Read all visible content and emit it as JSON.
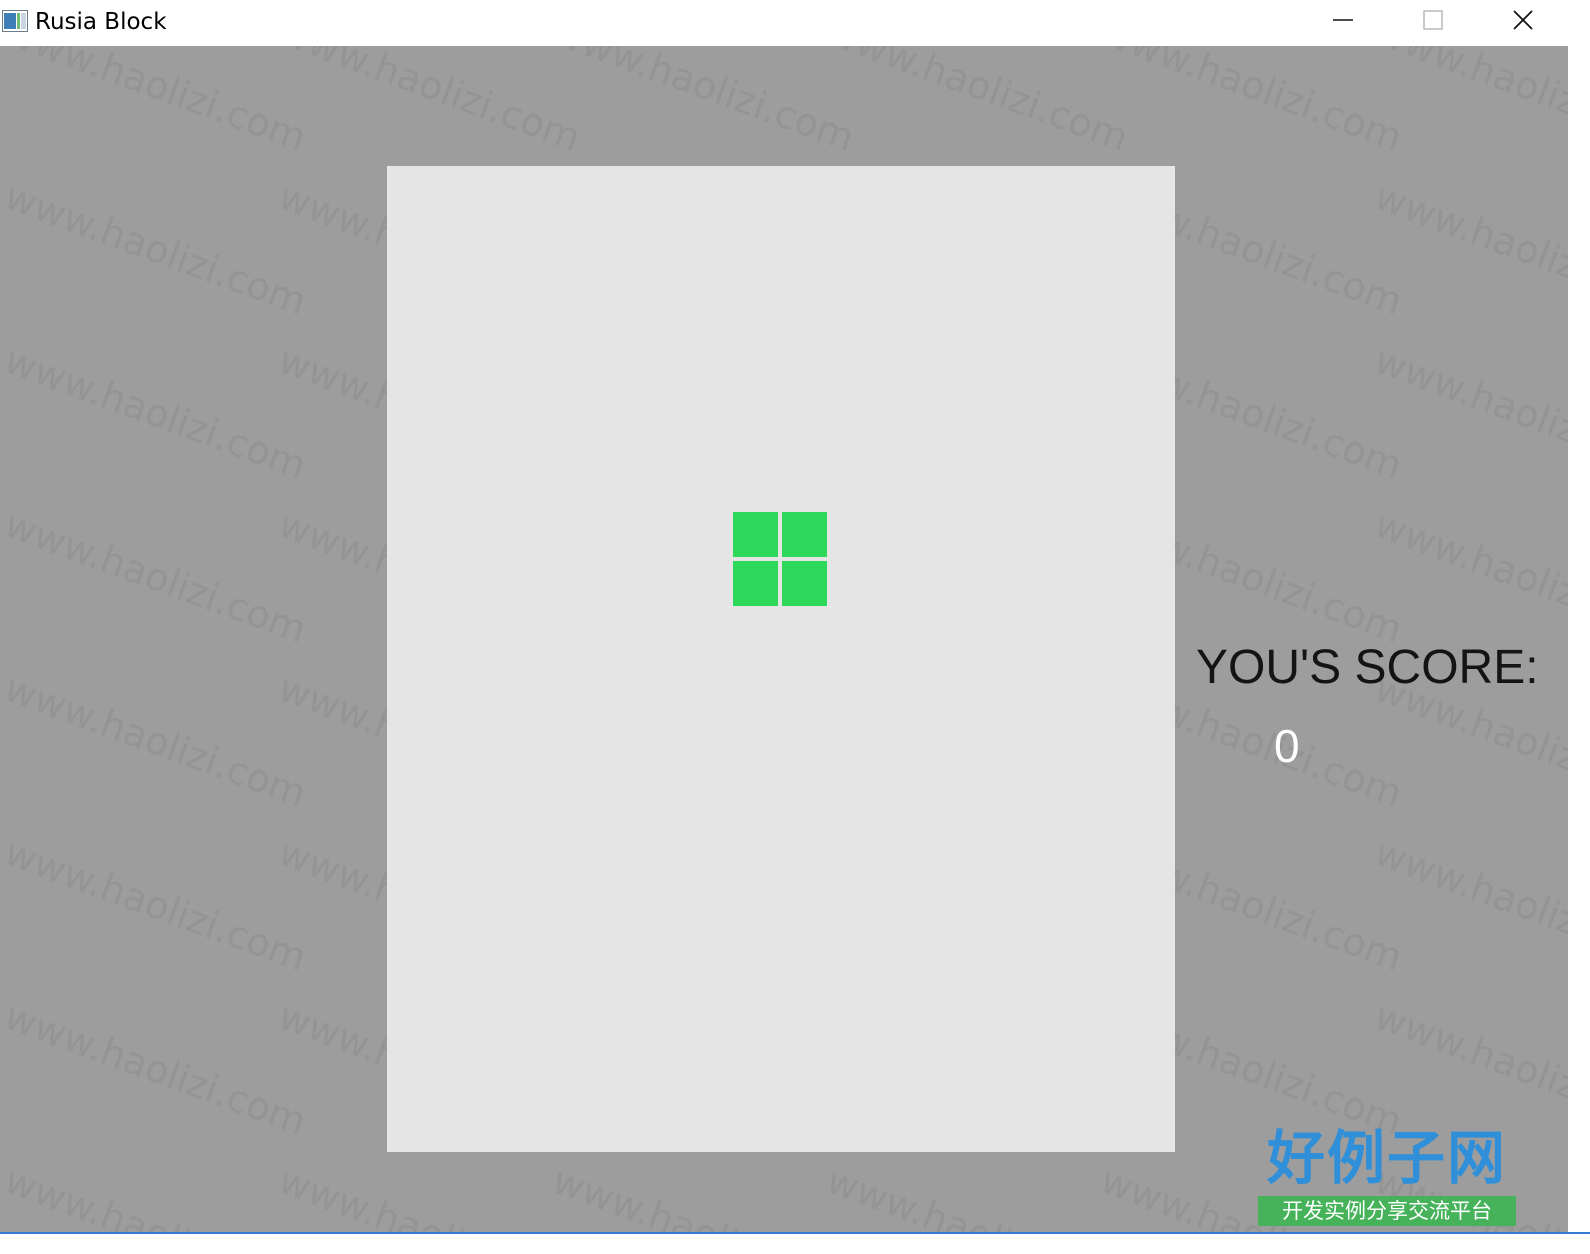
{
  "window": {
    "title": "Rusia Block",
    "background_color": "#9d9d9d",
    "board_color": "#e5e5e5"
  },
  "controls": {
    "minimize_icon": "minimize-icon",
    "maximize_icon": "maximize-icon",
    "close_icon": "close-icon"
  },
  "game": {
    "piece": {
      "shape": "O",
      "color": "#2ed85a",
      "grid": [
        [
          1,
          1
        ],
        [
          1,
          1
        ]
      ]
    },
    "score_label": "YOU'S SCORE:",
    "score_value": "0"
  },
  "watermark": {
    "text": "www.haolizi.com",
    "logo_title": "好例子网",
    "logo_subtitle": "开发实例分享交流平台"
  }
}
